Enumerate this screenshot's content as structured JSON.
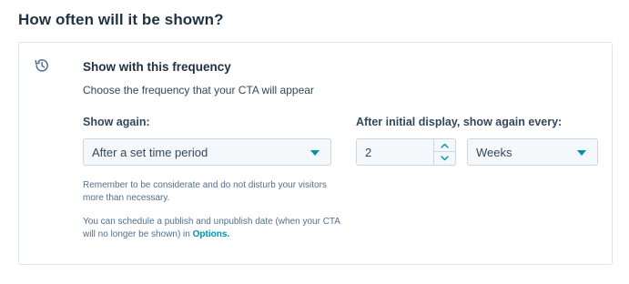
{
  "section": {
    "title": "How often will it be shown?"
  },
  "card": {
    "icon": "history-icon",
    "title": "Show with this frequency",
    "description": "Choose the frequency that your CTA will appear"
  },
  "show_again": {
    "label": "Show again:",
    "selected": "After a set time period"
  },
  "interval": {
    "label": "After initial display, show again every:",
    "value": "2",
    "unit_selected": "Weeks"
  },
  "help": {
    "note1": "Remember to be considerate and do not disturb your visitors more than necessary.",
    "note2_prefix": "You can schedule a publish and unpublish date (when your CTA will no longer be shown) in ",
    "note2_link": "Options."
  },
  "colors": {
    "accent": "#0091ae",
    "heading": "#213343",
    "text": "#33475b",
    "muted": "#516f90",
    "border": "#cbd6e2",
    "input_bg": "#f5f8fa"
  }
}
